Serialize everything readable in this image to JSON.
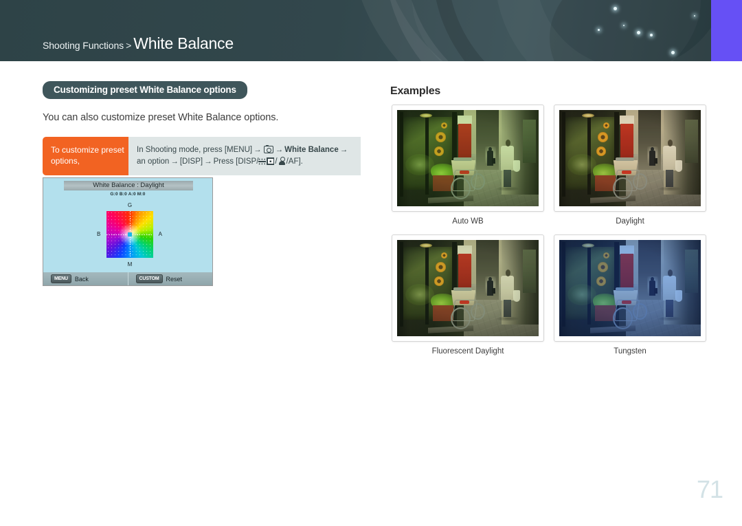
{
  "header": {
    "breadcrumb_parent": "Shooting Functions",
    "breadcrumb_separator": ">",
    "breadcrumb_current": "White Balance"
  },
  "left": {
    "section_title": "Customizing preset White Balance options",
    "intro_text": "You can also customize preset White Balance options.",
    "instruction": {
      "label": "To customize preset options,",
      "line1_pre": "In Shooting mode, press [MENU]",
      "line1_arrow": "→",
      "line1_camera_icon": "camera-icon",
      "line1_bold": "White Balance",
      "line2_pre": "an option",
      "line2_disp": "[DISP]",
      "line2_press": "Press [DISP/",
      "line2_icon_dots": "flicker-icon",
      "line2_icon_grid": "grid-icon",
      "line2_icon_timer": "self-timer-icon",
      "line2_end": "/AF]."
    }
  },
  "camera_screen": {
    "title": "White Balance : Daylight",
    "values": "G:0 B:0 A:0 M:0",
    "axis_top": "G",
    "axis_bottom": "M",
    "axis_left": "B",
    "axis_right": "A",
    "bottom_bar": [
      {
        "key": "MENU",
        "action": "Back"
      },
      {
        "key": "CUSTOM",
        "action": "Reset"
      }
    ]
  },
  "examples": {
    "heading": "Examples",
    "items": [
      {
        "caption": "Auto WB",
        "variant": "auto"
      },
      {
        "caption": "Daylight",
        "variant": "daylight"
      },
      {
        "caption": "Fluorescent Daylight",
        "variant": "fluorescent"
      },
      {
        "caption": "Tungsten",
        "variant": "tungsten"
      }
    ]
  },
  "footer": {
    "page_number": "71"
  },
  "colors": {
    "header_bg": "#33484d",
    "accent_orange": "#f26322",
    "pill_bg": "#3f565b",
    "instruction_bg": "#dfe6e6",
    "purple_band": "#6650f5",
    "page_number": "#d3e2e6"
  }
}
